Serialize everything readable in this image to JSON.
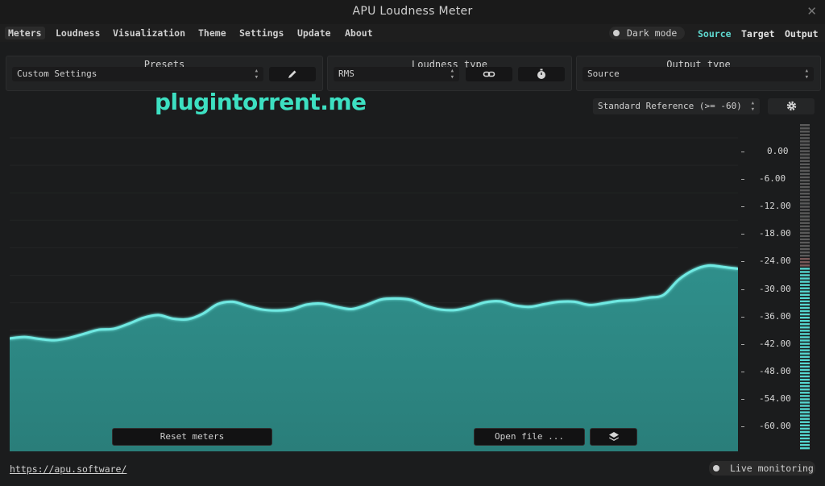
{
  "window": {
    "title": "APU Loudness Meter"
  },
  "menu": {
    "items": [
      "Meters",
      "Loudness",
      "Visualization",
      "Theme",
      "Settings",
      "Update",
      "About"
    ],
    "active": "Meters"
  },
  "dark_mode": {
    "label": "Dark mode"
  },
  "modes": {
    "source": "Source",
    "target": "Target",
    "output": "Output",
    "active": "Source"
  },
  "presets": {
    "title": "Presets",
    "value": "Custom Settings"
  },
  "loudness_type": {
    "title": "Loudness type",
    "value": "RMS"
  },
  "output_type": {
    "title": "Output type",
    "value": "Source"
  },
  "reference": {
    "value": "Standard Reference (>= -60)"
  },
  "watermark": "plugintorrent.me",
  "scale": {
    "labels": [
      "0.00",
      "-6.00",
      "-12.00",
      "-18.00",
      "-24.00",
      "-30.00",
      "-36.00",
      "-42.00",
      "-48.00",
      "-54.00",
      "-60.00"
    ]
  },
  "chart_data": {
    "type": "area",
    "y_range": [
      -66,
      0
    ],
    "values": [
      -40.8,
      -40.5,
      -40.9,
      -41.2,
      -40.7,
      -39.8,
      -38.9,
      -38.7,
      -37.6,
      -36.3,
      -35.7,
      -36.5,
      -36.6,
      -35.4,
      -33.3,
      -32.8,
      -33.7,
      -34.5,
      -34.7,
      -34.4,
      -33.4,
      -33.2,
      -33.9,
      -34.4,
      -33.5,
      -32.3,
      -32.1,
      -32.4,
      -33.7,
      -34.5,
      -34.6,
      -33.9,
      -32.9,
      -32.7,
      -33.6,
      -33.9,
      -33.3,
      -32.8,
      -32.8,
      -33.5,
      -33.1,
      -32.6,
      -32.4,
      -31.9,
      -31.3,
      -28.0,
      -25.9,
      -24.9,
      -25.2,
      -25.6
    ]
  },
  "buttons": {
    "reset": "Reset meters",
    "open_file": "Open file ..."
  },
  "footer": {
    "link": "https://apu.software/",
    "live": "Live monitoring"
  },
  "colors": {
    "accent": "#5fd9d0",
    "fill": "#2e8c88",
    "line": "#6fe9e2"
  }
}
